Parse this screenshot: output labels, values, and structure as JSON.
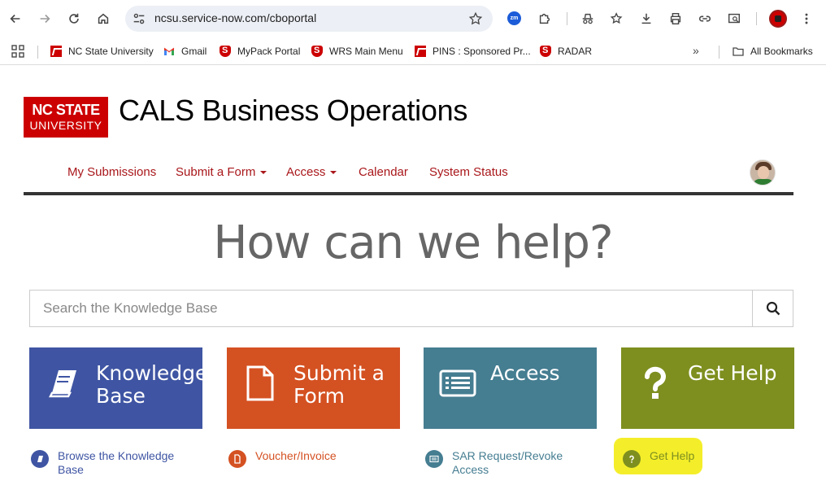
{
  "browser": {
    "url": "ncsu.service-now.com/cboportal",
    "zoom_label": "zm"
  },
  "bookmarks": [
    {
      "label": "NC State University",
      "icon": "ncsu-icon"
    },
    {
      "label": "Gmail",
      "icon": "gmail-icon"
    },
    {
      "label": "MyPack Portal",
      "icon": "shield-icon"
    },
    {
      "label": "WRS Main Menu",
      "icon": "shield-icon"
    },
    {
      "label": "PINS : Sponsored Pr...",
      "icon": "ncsu-icon"
    },
    {
      "label": "RADAR",
      "icon": "shield-icon"
    }
  ],
  "bookmarks_more": "»",
  "all_bookmarks": "All Bookmarks",
  "header": {
    "logo_line1": "NC STATE",
    "logo_line2": "UNIVERSITY",
    "title": "CALS Business Operations"
  },
  "nav": [
    {
      "label": "My Submissions"
    },
    {
      "label": "Submit a Form"
    },
    {
      "label": "Access"
    },
    {
      "label": "Calendar"
    },
    {
      "label": "System Status"
    }
  ],
  "hero": "How can we help?",
  "search": {
    "placeholder": "Search the Knowledge Base"
  },
  "tiles": [
    {
      "line1": "Knowledge",
      "line2": "Base",
      "color": "#3f55a3"
    },
    {
      "line1": "Submit a",
      "line2": "Form",
      "color": "#d45122"
    },
    {
      "line1": "Access",
      "line2": "",
      "color": "#457d91"
    },
    {
      "line1": "Get Help",
      "line2": "",
      "color": "#7e8f1f"
    }
  ],
  "links": [
    {
      "line1": "Browse the Knowledge",
      "line2": "Base",
      "color": "#3f55a3"
    },
    {
      "line1": "Voucher/Invoice",
      "line2": "",
      "color": "#d45122"
    },
    {
      "line1": "SAR Request/Revoke",
      "line2": "Access",
      "color": "#457d91"
    },
    {
      "line1": "Get Help",
      "line2": "",
      "color": "#7e8f1f"
    }
  ]
}
